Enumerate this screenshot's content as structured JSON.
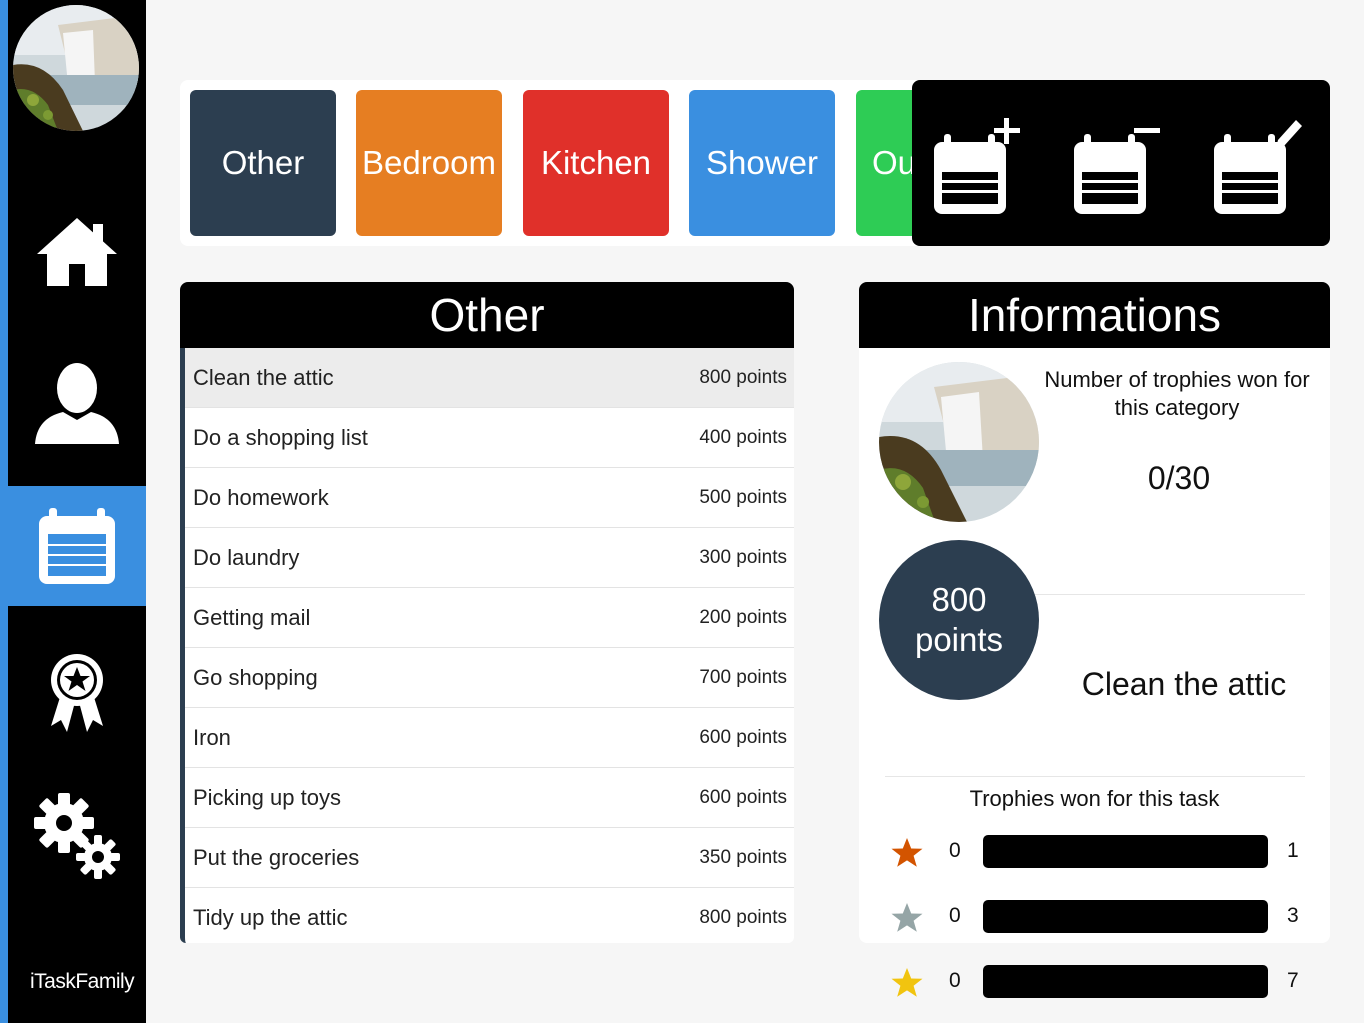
{
  "sidebar": {
    "brand": "iTaskFamily",
    "items": [
      {
        "name": "home-icon"
      },
      {
        "name": "user-icon"
      },
      {
        "name": "calendar-icon",
        "active": true
      },
      {
        "name": "award-ribbon-icon"
      },
      {
        "name": "gears-icon"
      }
    ]
  },
  "categories": [
    {
      "label": "Other",
      "color": "#2c3e50"
    },
    {
      "label": "Bedroom",
      "color": "#e67e22"
    },
    {
      "label": "Kitchen",
      "color": "#e0302a"
    },
    {
      "label": "Shower",
      "color": "#3a8fe0"
    },
    {
      "label": "Outside",
      "color": "#2ecc55"
    }
  ],
  "toolbar": {
    "icons": [
      "calendar-add-icon",
      "calendar-remove-icon",
      "calendar-edit-icon"
    ]
  },
  "tasks": {
    "title": "Other",
    "items": [
      {
        "name": "Clean the attic",
        "points": "800 points"
      },
      {
        "name": "Do a shopping list",
        "points": "400 points"
      },
      {
        "name": "Do homework",
        "points": "500 points"
      },
      {
        "name": "Do laundry",
        "points": "300 points"
      },
      {
        "name": "Getting mail",
        "points": "200 points"
      },
      {
        "name": "Go shopping",
        "points": "700 points"
      },
      {
        "name": "Iron",
        "points": "600 points"
      },
      {
        "name": "Picking up toys",
        "points": "600 points"
      },
      {
        "name": "Put the groceries",
        "points": "350 points"
      },
      {
        "name": "Tidy up the attic",
        "points": "800 points"
      }
    ]
  },
  "info": {
    "title": "Informations",
    "category_trophies_label": "Number of trophies won for this category",
    "category_trophies_count": "0/30",
    "points_value": "800",
    "points_unit": "points",
    "task_name": "Clean the attic",
    "trophies_title": "Trophies won for this task",
    "trophies": [
      {
        "star_color": "#d35400",
        "current": "0",
        "goal": "1",
        "progress": 0
      },
      {
        "star_color": "#95a5a6",
        "current": "0",
        "goal": "3",
        "progress": 0
      },
      {
        "star_color": "#f1c40f",
        "current": "0",
        "goal": "7",
        "progress": 0
      }
    ]
  }
}
